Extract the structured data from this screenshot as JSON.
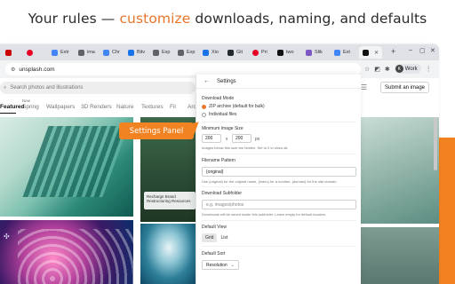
{
  "headline": {
    "prefix": "Your rules — ",
    "accent": "customize",
    "suffix": " downloads, naming, and defaults"
  },
  "browser": {
    "tabs": [
      {
        "label": "",
        "color": "#cc0000"
      },
      {
        "label": "",
        "color": "#e60023"
      },
      {
        "label": "Extr",
        "color": "#4285f4"
      },
      {
        "label": "ima",
        "color": "#5f6368"
      },
      {
        "label": "Chr",
        "color": "#4285f4"
      },
      {
        "label": "Bitv",
        "color": "#1a73e8"
      },
      {
        "label": "Exp",
        "color": "#5f6368"
      },
      {
        "label": "Exp",
        "color": "#5f6368"
      },
      {
        "label": "Xio",
        "color": "#1a73e8"
      },
      {
        "label": "Git",
        "color": "#24292e"
      },
      {
        "label": "Pri",
        "color": "#e60023"
      },
      {
        "label": "two",
        "color": "#111111"
      },
      {
        "label": "Slik",
        "color": "#7e57c2"
      },
      {
        "label": "Ext",
        "color": "#4285f4"
      },
      {
        "label": "",
        "color": "#111111"
      }
    ],
    "new_tab": "+",
    "url": "unsplash.com",
    "profile_initial": "K",
    "profile_label": "Work"
  },
  "site": {
    "search_placeholder": "Search photos and illustrations",
    "submit_label": "Submit an image",
    "categories": [
      "Featured",
      "Spring",
      "Wallpapers",
      "3D Renders",
      "Nature",
      "Textures",
      "Fil",
      "Arc"
    ],
    "new_badge": "New",
    "tile_tag": {
      "line1": "Recharge Brand",
      "line2": "Restructuring Resources"
    }
  },
  "settings": {
    "back": "←",
    "title": "Settings",
    "download_mode": {
      "label": "Download Mode",
      "options": [
        "ZIP archive (default for bulk)",
        "Individual files"
      ],
      "selected": 0
    },
    "min_size": {
      "label": "Minimum Image Size",
      "width": "200",
      "height": "200",
      "separator": "x",
      "unit": "px",
      "help": "Images below this size are hidden. Set to 0 to show all."
    },
    "filename": {
      "label": "Filename Pattern",
      "value": "{original}",
      "help": "Use {original} for the original name, {index} for a number, {domain} for the site domain."
    },
    "subfolder": {
      "label": "Download Subfolder",
      "placeholder": "e.g. images/photos",
      "help": "Downloads will be saved inside this subfolder. Leave empty for default location."
    },
    "default_view": {
      "label": "Default View",
      "options": [
        "Grid",
        "List"
      ],
      "selected": 0
    },
    "default_sort": {
      "label": "Default Sort",
      "value": "Resolution"
    }
  },
  "callout": "Settings Panel"
}
